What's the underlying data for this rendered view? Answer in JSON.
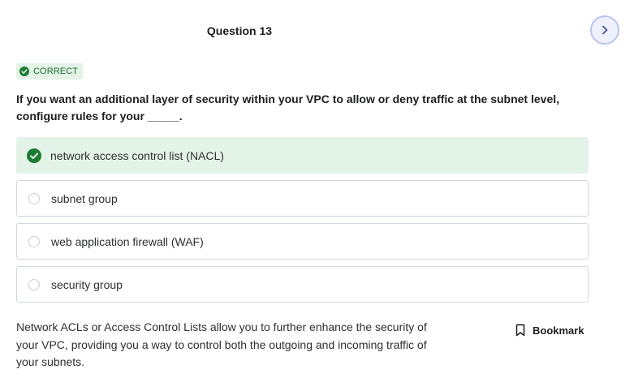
{
  "question": {
    "title": "Question 13",
    "status": "CORRECT",
    "text": "If you want an additional layer of security within your VPC to allow or deny traffic at the subnet level, configure rules for your _____.",
    "options": [
      {
        "label": "network access control list (NACL)",
        "state": "correct"
      },
      {
        "label": "subnet group",
        "state": "unselected"
      },
      {
        "label": "web application firewall (WAF)",
        "state": "unselected"
      },
      {
        "label": "security group",
        "state": "unselected"
      }
    ]
  },
  "explanation": {
    "text": "Network ACLs or Access Control Lists allow you to further enhance the security of your VPC, providing you a way to control both the outgoing and incoming traffic of your subnets."
  },
  "actions": {
    "bookmark_label": "Bookmark"
  },
  "icons": {
    "next": "chevron-right-icon",
    "status": "check-circle-icon",
    "bookmark": "bookmark-icon"
  },
  "colors": {
    "correct_green": "#1e7b34",
    "correct_background": "#e4f3e7",
    "accent_blue": "#5c6fc4"
  }
}
